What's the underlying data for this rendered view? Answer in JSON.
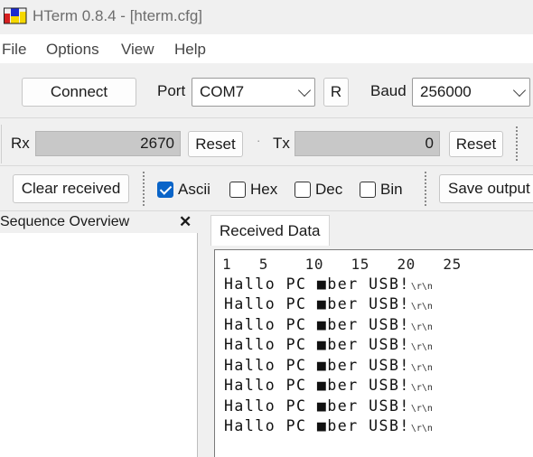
{
  "window": {
    "title": "HTerm 0.8.4 - [hterm.cfg]"
  },
  "menu": [
    "File",
    "Options",
    "View",
    "Help"
  ],
  "connection": {
    "connect_label": "Connect",
    "port_label": "Port",
    "port_value": "COM7",
    "r_label": "R",
    "baud_label": "Baud",
    "baud_value": "256000"
  },
  "counters": {
    "rx_label": "Rx",
    "rx_value": "2670",
    "rx_reset": "Reset",
    "tx_label": "Tx",
    "tx_value": "0",
    "tx_reset": "Reset"
  },
  "display": {
    "clear_label": "Clear received",
    "ascii_label": "Ascii",
    "ascii_checked": true,
    "hex_label": "Hex",
    "dec_label": "Dec",
    "bin_label": "Bin",
    "save_label": "Save output"
  },
  "sequence": {
    "title": "Sequence Overview",
    "close_glyph": "✕"
  },
  "received": {
    "tab_label": "Received Data",
    "ruler": "1   5    10   15   20   25",
    "lines": [
      "Hallo PC ■ber USB!",
      "Hallo PC ■ber USB!",
      "Hallo PC ■ber USB!",
      "Hallo PC ■ber USB!",
      "Hallo PC ■ber USB!",
      "Hallo PC ■ber USB!",
      "Hallo PC ■ber USB!",
      "Hallo PC ■ber USB!"
    ],
    "line_end": "\\r\\n"
  },
  "colors": {
    "accent": "#0a64c8",
    "counter_bg": "#c8c8c8"
  }
}
